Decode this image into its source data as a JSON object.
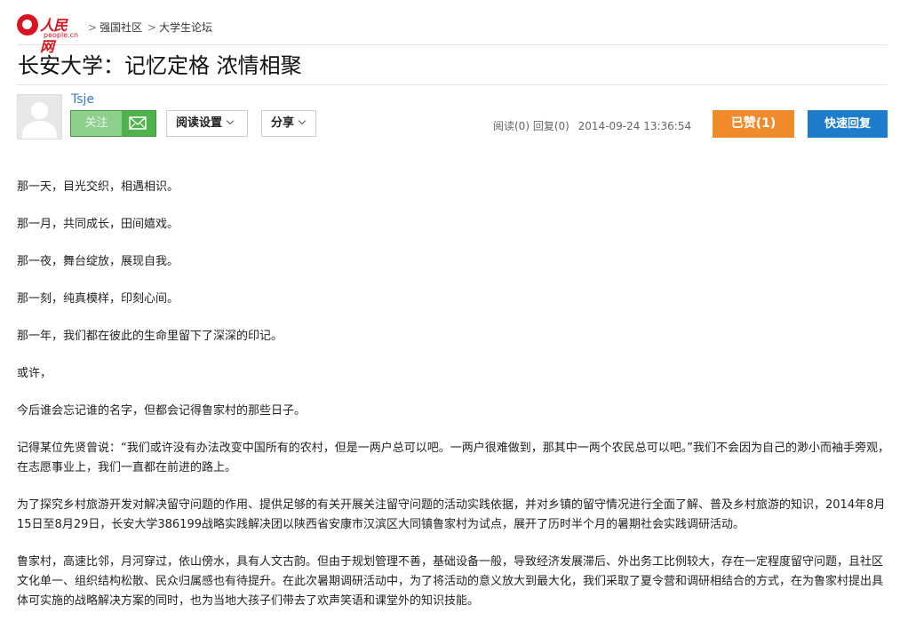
{
  "site": {
    "logo_cn": "人民网",
    "logo_en": "people.cn"
  },
  "breadcrumb": [
    {
      "label": "强国社区"
    },
    {
      "label": "大学生论坛"
    }
  ],
  "post": {
    "title": "长安大学：记忆定格 浓情相聚",
    "author": "Tsje",
    "follow_label": "关注",
    "read_settings_label": "阅读设置",
    "share_label": "分享",
    "read_count": "阅读(0)",
    "reply_count": "回复(0)",
    "timestamp": "2014-09-24 13:36:54",
    "like_label": "已赞(1)",
    "quick_reply_label": "快速回复"
  },
  "colors": {
    "brand_red": "#d9131f",
    "follow_green": "#4fb34d",
    "like_orange": "#f08a2b",
    "reply_blue": "#1d7dcc",
    "link_blue": "#3b7dc4"
  },
  "icons": [
    "people-logo-icon",
    "mail-icon",
    "chevron-down-icon",
    "default-avatar-icon"
  ],
  "article": {
    "paragraphs": [
      "那一天，目光交织，相遇相识。",
      "那一月，共同成长，田间嬉戏。",
      "那一夜，舞台绽放，展现自我。",
      "那一刻，纯真模样，印刻心间。",
      "那一年，我们都在彼此的生命里留下了深深的印记。",
      "或许，",
      "今后谁会忘记谁的名字，但都会记得鲁家村的那些日子。",
      "记得某位先贤曾说：“我们或许没有办法改变中国所有的农村，但是一两户总可以吧。一两户很难做到，那其中一两个农民总可以吧。”我们不会因为自己的渺小而袖手旁观，在志愿事业上，我们一直都在前进的路上。",
      "为了探究乡村旅游开发对解决留守问题的作用、提供足够的有关开展关注留守问题的活动实践依据，并对乡镇的留守情况进行全面了解、普及乡村旅游的知识，2014年8月15日至8月29日，长安大学386199战略实践解决团以陕西省安康市汉滨区大同镇鲁家村为试点，展开了历时半个月的暑期社会实践调研活动。",
      "鲁家村，高速比邻，月河穿过，依山傍水，具有人文古韵。但由于规划管理不善，基础设备一般，导致经济发展滞后、外出务工比例较大，存在一定程度留守问题，且社区文化单一、组织结构松散、民众归属感也有待提升。在此次暑期调研活动中，为了将活动的意义放大到最大化，我们采取了夏令营和调研相结合的方式，在为鲁家村提出具体可实施的战略解决方案的同时，也为当地大孩子们带去了欢声笑语和课堂外的知识技能。"
    ]
  }
}
